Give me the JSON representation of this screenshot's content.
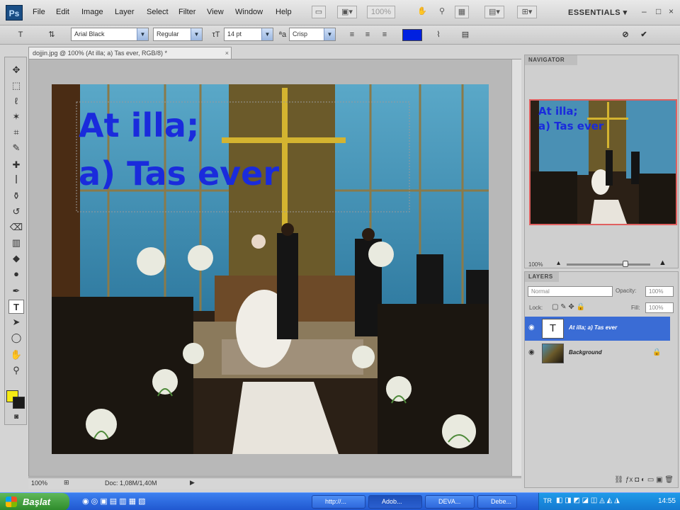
{
  "menubar": {
    "app_icon": "Ps",
    "items": [
      "File",
      "Edit",
      "Image",
      "Layer",
      "Select",
      "Filter",
      "View",
      "Window",
      "Help"
    ],
    "zoom": "100%",
    "workspace": "ESSENTIALS",
    "window_controls": [
      "–",
      "□",
      "×"
    ]
  },
  "options": {
    "font_family": "Arial Black",
    "font_style": "Regular",
    "font_size": "14 pt",
    "antialias": "Crisp",
    "text_color": "#0020e0"
  },
  "document": {
    "tab_title": "dojjin.jpg @ 100% (At illa; a) Tas ever, RGB/8) *",
    "text_line1": "At illa;",
    "text_line2": "a) Tas ever",
    "text_color": "#1a2bdc"
  },
  "status": {
    "zoom": "100%",
    "doc_size": "Doc: 1,08M/1,40M"
  },
  "navigator": {
    "title": "NAVIGATOR",
    "zoom": "100%",
    "text_line1": "At illa;",
    "text_line2": "a) Tas ever"
  },
  "layers": {
    "title": "LAYERS",
    "blend_mode": "Normal",
    "opacity_label": "Opacity:",
    "opacity": "100%",
    "lock_label": "Lock:",
    "fill_label": "Fill:",
    "fill": "100%",
    "items": [
      {
        "name": "At illa; a) Tas ever",
        "type": "text",
        "thumb": "T"
      },
      {
        "name": "Background",
        "type": "image"
      }
    ]
  },
  "taskbar": {
    "start_label": "Başlat",
    "tasks": [
      "http://...",
      "Adob...",
      "DEVA...",
      "Debe..."
    ],
    "lang": "TR",
    "clock": "14:55"
  }
}
